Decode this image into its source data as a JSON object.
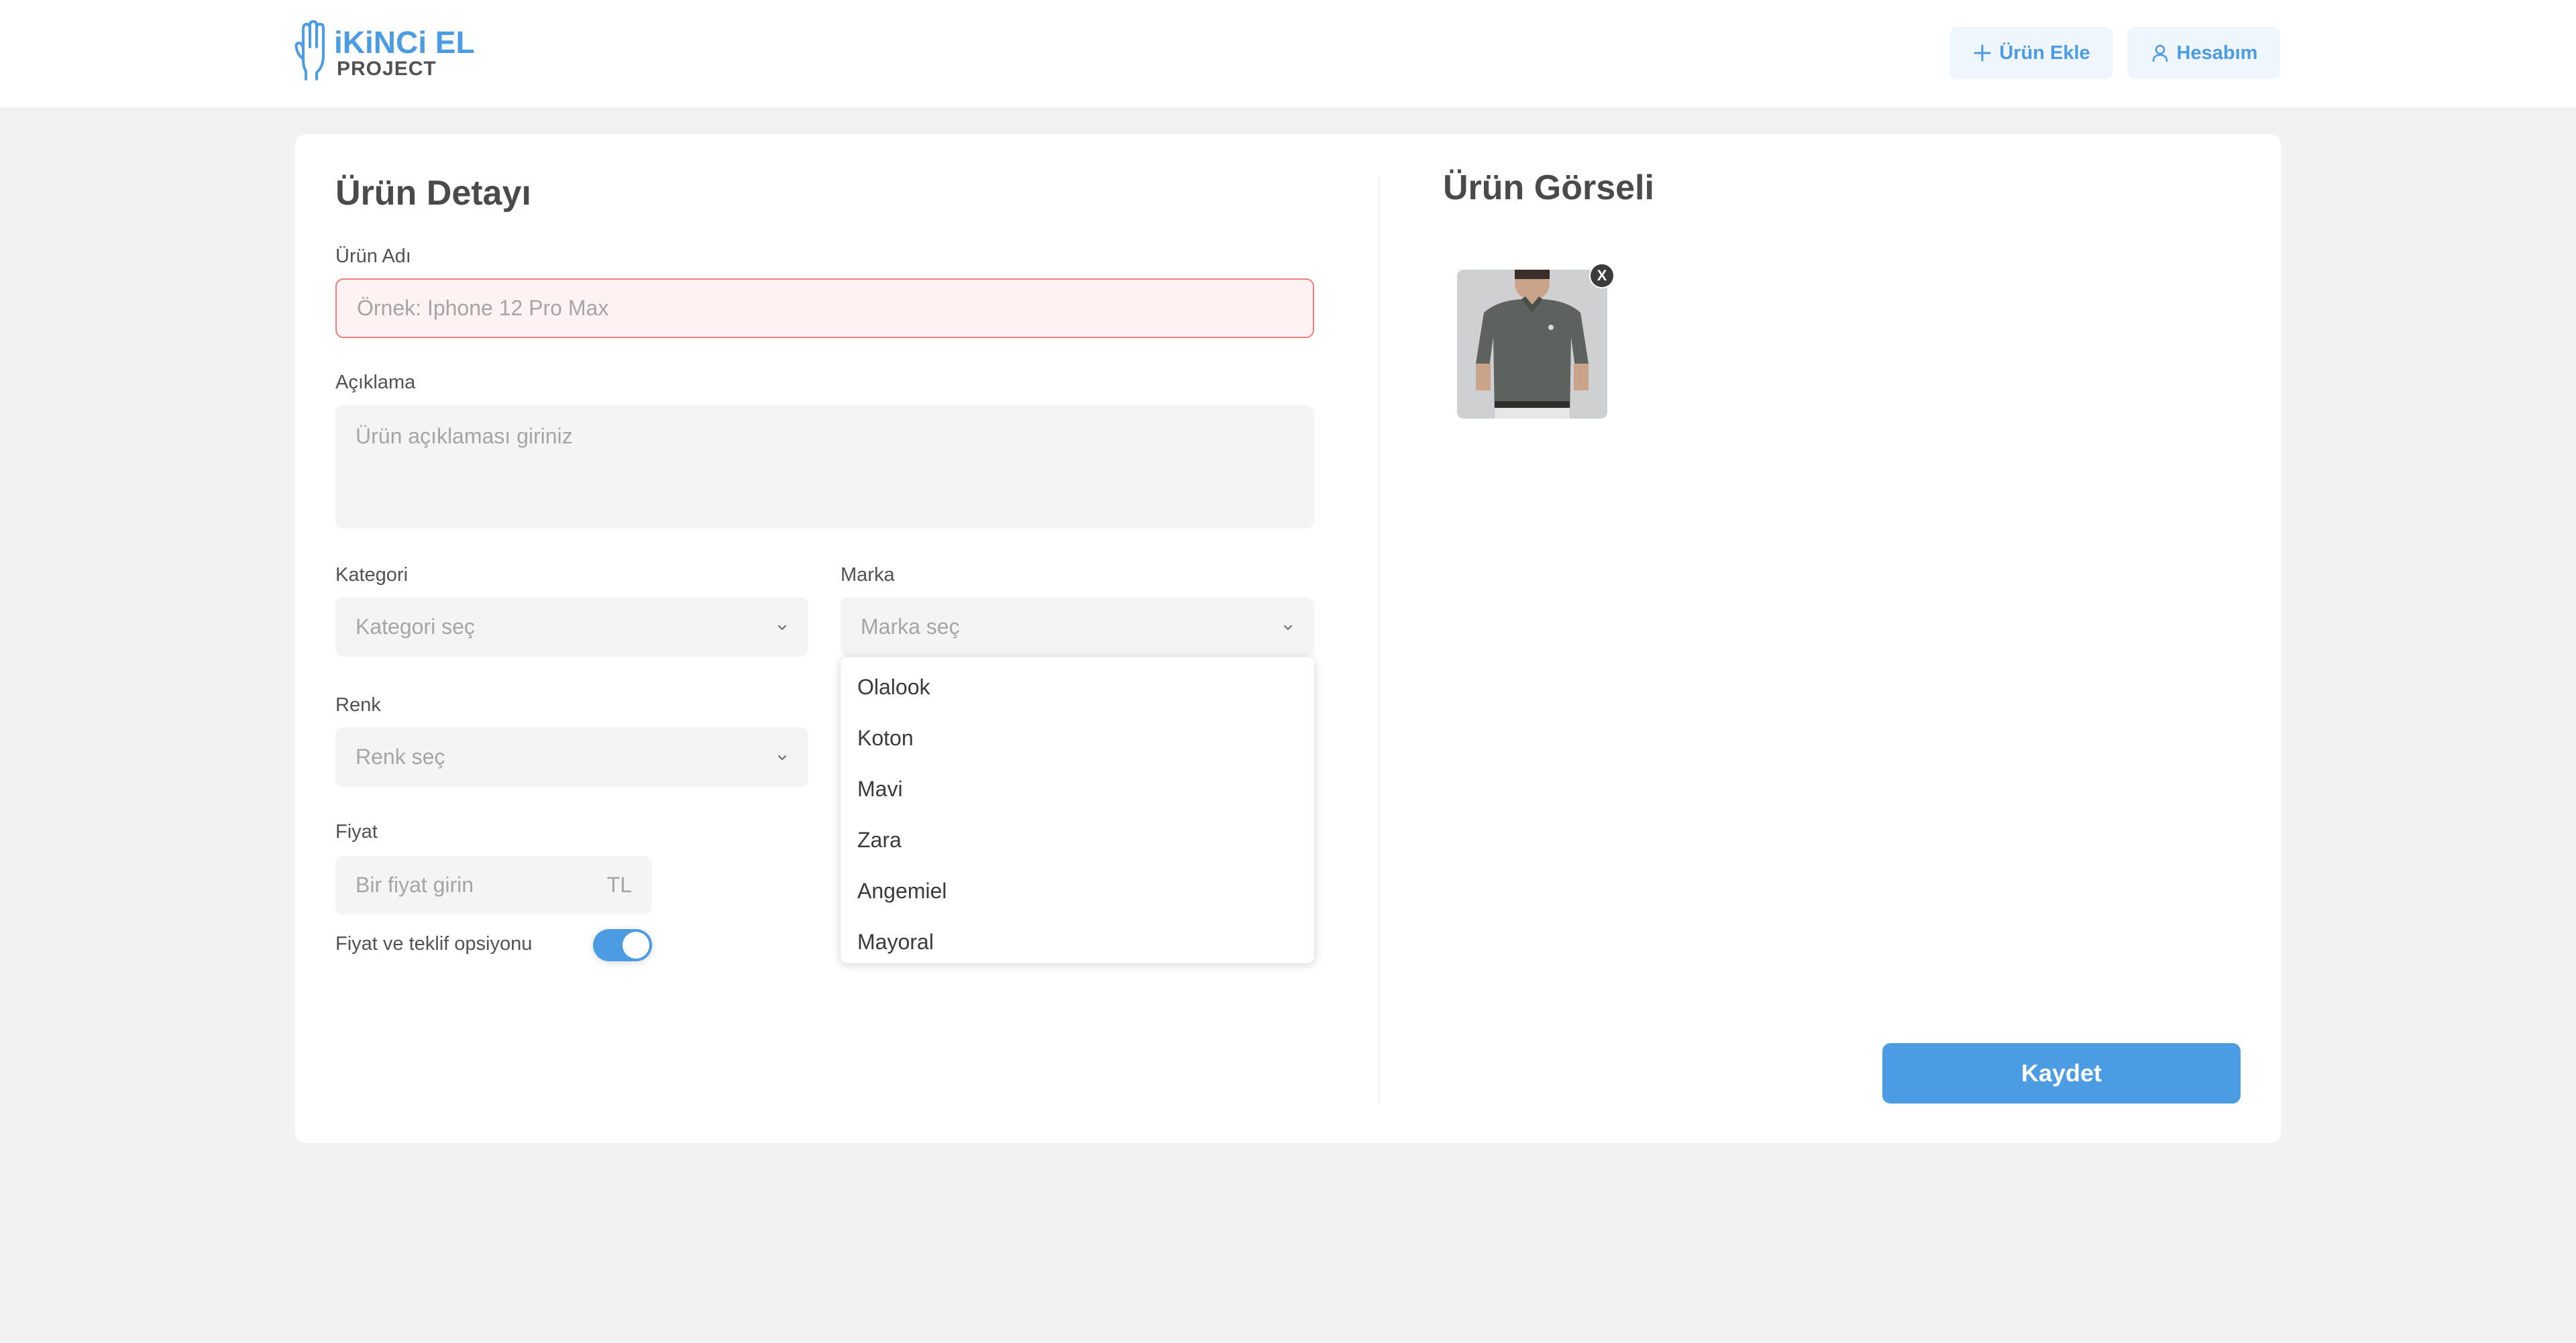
{
  "header": {
    "logo_title": "iKiNCi EL",
    "logo_subtitle": "PROJECT",
    "add_product_label": "Ürün Ekle",
    "account_label": "Hesabım"
  },
  "form": {
    "title": "Ürün Detayı",
    "name_label": "Ürün Adı",
    "name_placeholder": "Örnek: Iphone 12 Pro Max",
    "description_label": "Açıklama",
    "description_placeholder": "Ürün açıklaması giriniz",
    "category_label": "Kategori",
    "category_placeholder": "Kategori seç",
    "brand_label": "Marka",
    "brand_placeholder": "Marka seç",
    "color_label": "Renk",
    "color_placeholder": "Renk seç",
    "price_label": "Fiyat",
    "price_placeholder": "Bir fiyat girin",
    "price_suffix": "TL",
    "offer_toggle_label": "Fiyat ve teklif opsiyonu",
    "offer_toggle_on": true
  },
  "brand_dropdown": {
    "options": [
      "Olalook",
      "Koton",
      "Mavi",
      "Zara",
      "Angemiel",
      "Mayoral"
    ]
  },
  "image_section": {
    "title": "Ürün Görseli",
    "remove_label": "X"
  },
  "save_label": "Kaydet",
  "colors": {
    "accent": "#4b9ce2",
    "error_border": "#f47c7c",
    "error_bg": "#fff2f2",
    "input_bg": "#f4f4f4",
    "page_bg": "#f2f2f2"
  }
}
